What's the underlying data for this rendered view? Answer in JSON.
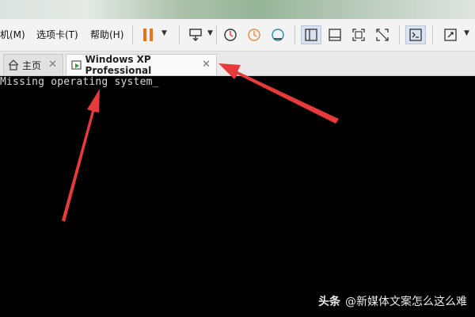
{
  "menu": {
    "vm_label": "机(M)",
    "tabs_label": "选项卡(T)",
    "help_label": "帮助(H)"
  },
  "tabs": [
    {
      "label": "主页",
      "icon": "home-icon"
    },
    {
      "label": "Windows XP Professional",
      "icon": "vm-icon"
    }
  ],
  "console": {
    "message": "Missing operating system_"
  },
  "watermark": {
    "brand": "头条",
    "handle": "@新媒体文案怎么这么难"
  },
  "colors": {
    "pause_accent": "#e8731a",
    "annotation_arrow": "#e53b3b",
    "console_bg": "#000000"
  }
}
